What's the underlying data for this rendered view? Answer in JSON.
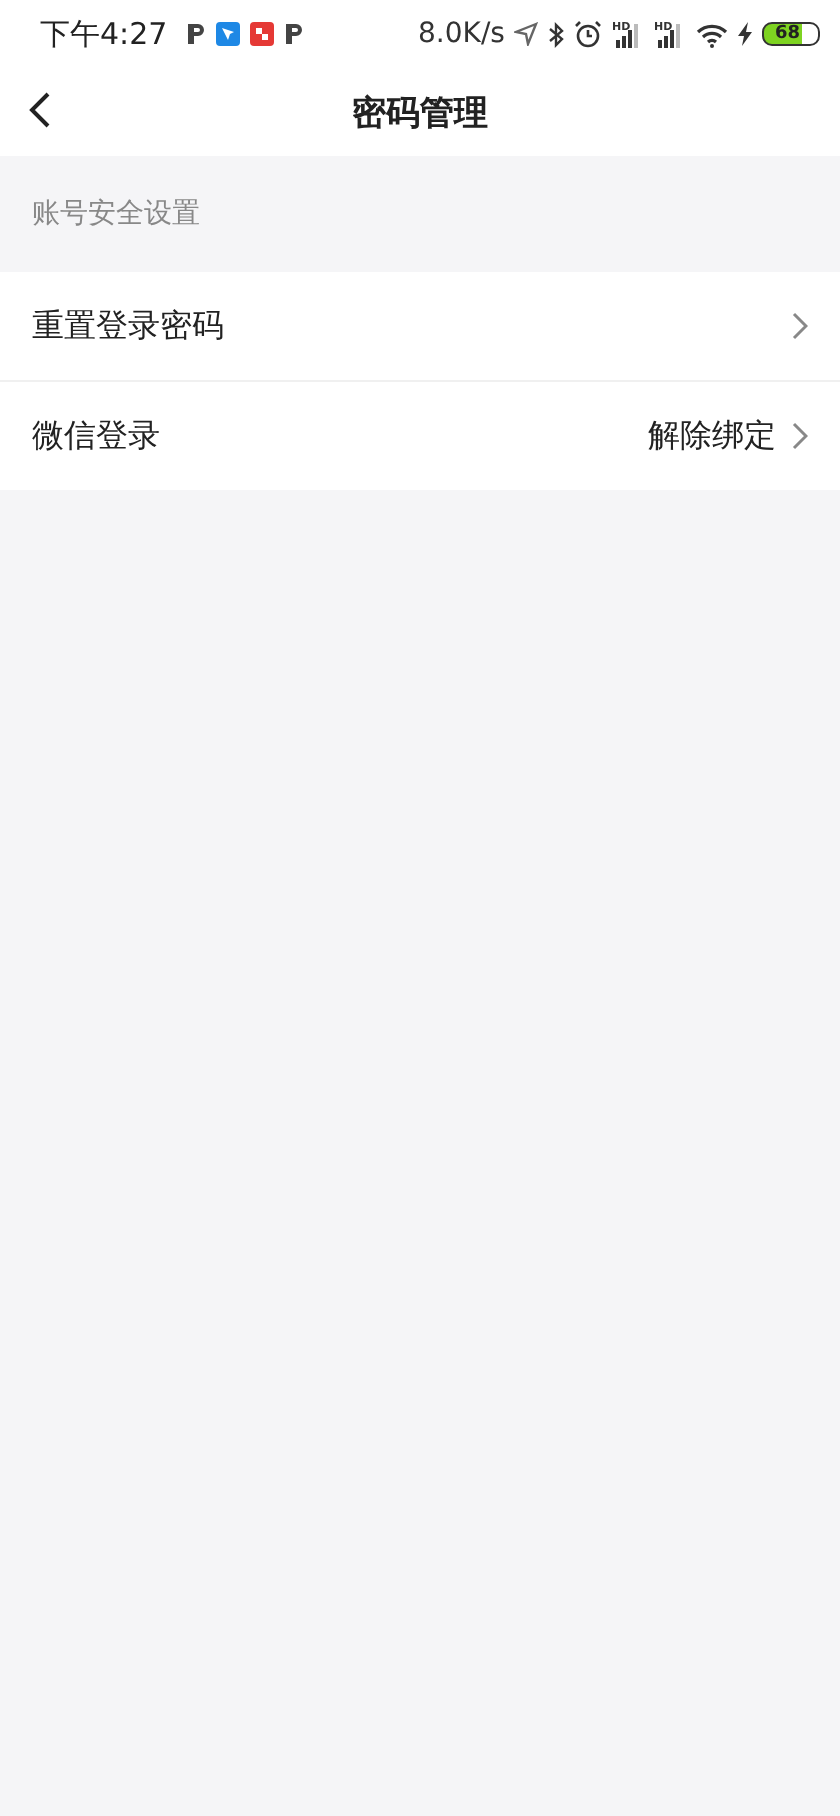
{
  "status_bar": {
    "time": "下午4:27",
    "net_speed": "8.0K/s",
    "signal_labels": [
      "HD",
      "HD"
    ],
    "battery": "68"
  },
  "nav": {
    "title": "密码管理"
  },
  "section": {
    "title": "账号安全设置"
  },
  "rows": [
    {
      "label": "重置登录密码"
    },
    {
      "label": "微信登录",
      "value": "解除绑定"
    }
  ]
}
